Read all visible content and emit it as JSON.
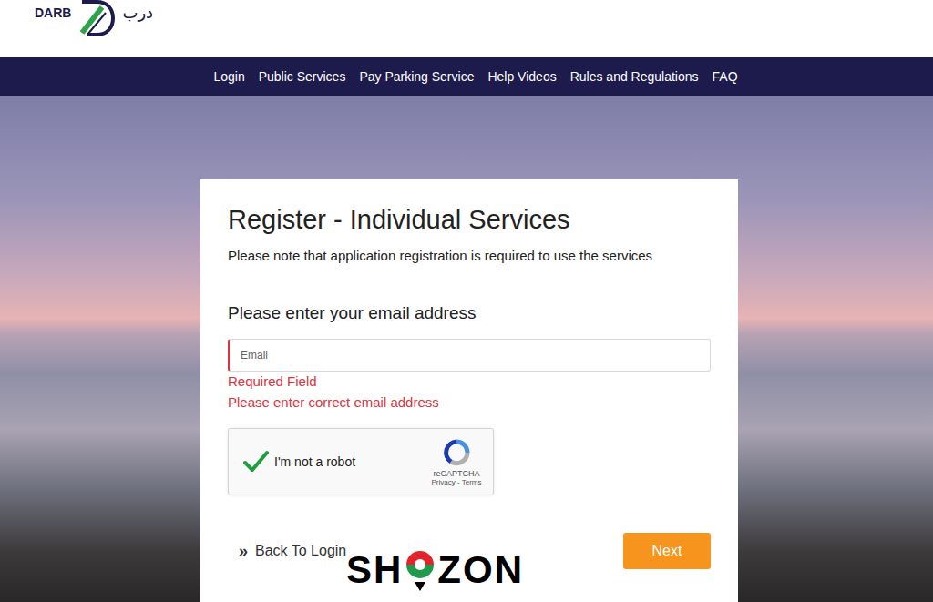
{
  "logo": {
    "latin": "DARB",
    "arabic": "درب"
  },
  "nav": [
    "Login",
    "Public Services",
    "Pay Parking Service",
    "Help Videos",
    "Rules and Regulations",
    "FAQ"
  ],
  "card": {
    "title": "Register - Individual Services",
    "note": "Please note that application registration is required to use the services",
    "prompt": "Please enter your email address",
    "email": {
      "placeholder": "Email",
      "value": "",
      "invalid": true
    },
    "errors": [
      "Required Field",
      "Please enter correct email address"
    ],
    "captcha": {
      "label": "I'm not a robot",
      "checked": true,
      "brand": "reCAPTCHA",
      "links": "Privacy - Terms"
    },
    "back": {
      "icon": "»",
      "label": "Back To Login"
    },
    "next": "Next"
  },
  "watermark": {
    "before": "SH",
    "after": "ZON"
  }
}
